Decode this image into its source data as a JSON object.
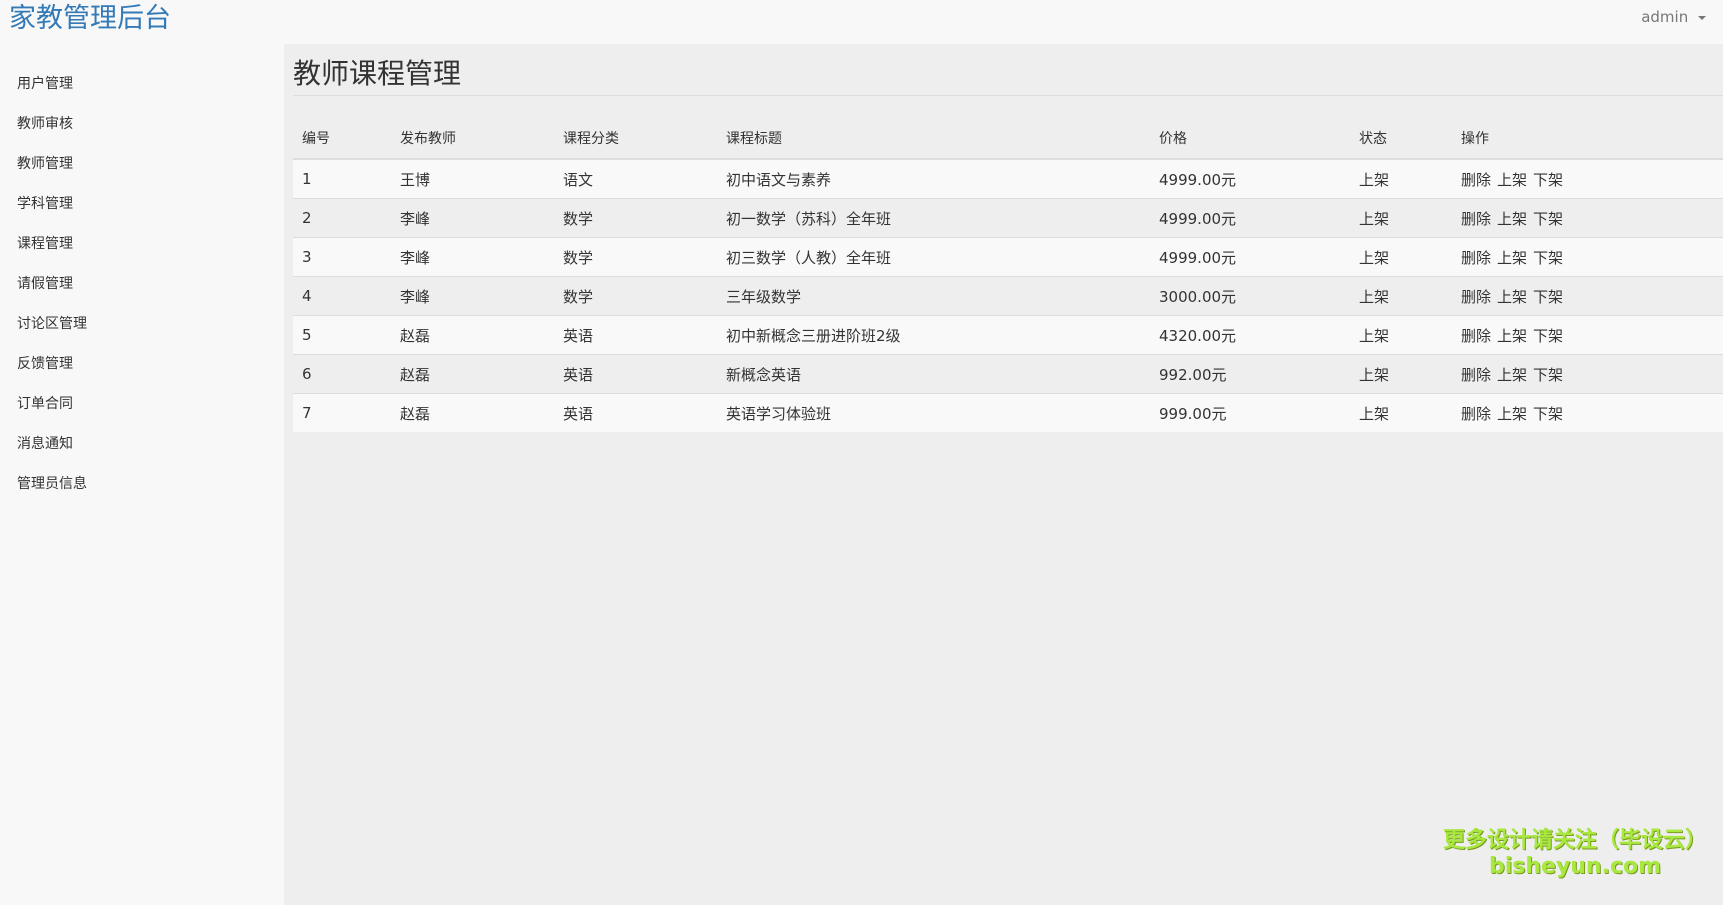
{
  "app": {
    "title": "家教管理后台",
    "user": "admin"
  },
  "sidebar": {
    "items": [
      {
        "label": "用户管理"
      },
      {
        "label": "教师审核"
      },
      {
        "label": "教师管理"
      },
      {
        "label": "学科管理"
      },
      {
        "label": "课程管理"
      },
      {
        "label": "请假管理"
      },
      {
        "label": "讨论区管理"
      },
      {
        "label": "反馈管理"
      },
      {
        "label": "订单合同"
      },
      {
        "label": "消息通知"
      },
      {
        "label": "管理员信息"
      }
    ]
  },
  "main": {
    "title": "教师课程管理",
    "columns": [
      "编号",
      "发布教师",
      "课程分类",
      "课程标题",
      "价格",
      "状态",
      "操作"
    ],
    "actions": {
      "delete": "删除",
      "list": "上架",
      "unlist": "下架"
    },
    "rows": [
      {
        "id": "1",
        "teacher": "王博",
        "category": "语文",
        "title": "初中语文与素养",
        "price": "4999.00元",
        "status": "上架"
      },
      {
        "id": "2",
        "teacher": "李峰",
        "category": "数学",
        "title": "初一数学（苏科）全年班",
        "price": "4999.00元",
        "status": "上架"
      },
      {
        "id": "3",
        "teacher": "李峰",
        "category": "数学",
        "title": "初三数学（人教）全年班",
        "price": "4999.00元",
        "status": "上架"
      },
      {
        "id": "4",
        "teacher": "李峰",
        "category": "数学",
        "title": "三年级数学",
        "price": "3000.00元",
        "status": "上架"
      },
      {
        "id": "5",
        "teacher": "赵磊",
        "category": "英语",
        "title": "初中新概念三册进阶班2级",
        "price": "4320.00元",
        "status": "上架"
      },
      {
        "id": "6",
        "teacher": "赵磊",
        "category": "英语",
        "title": "新概念英语",
        "price": "992.00元",
        "status": "上架"
      },
      {
        "id": "7",
        "teacher": "赵磊",
        "category": "英语",
        "title": "英语学习体验班",
        "price": "999.00元",
        "status": "上架"
      }
    ]
  },
  "watermark": {
    "line1": "更多设计请关注（毕设云）",
    "line2": "bisheyun.com"
  },
  "colors": {
    "brand": "#337ab7",
    "watermark": "#a8e840"
  }
}
